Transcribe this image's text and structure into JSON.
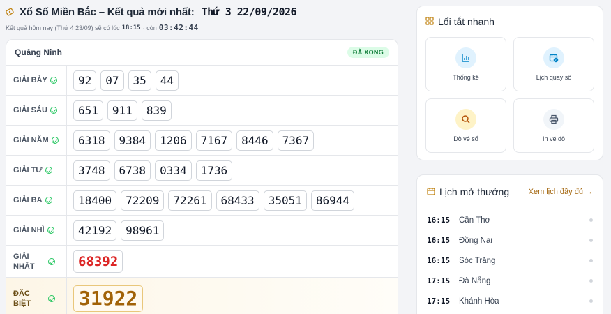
{
  "header": {
    "title": "Xổ Số Miền Bắc – Kết quả mới nhất:",
    "date": "Thứ 3  22/09/2026",
    "sub_prefix": "Kết quả hôm nay (Thứ 4 23/09) sẽ có lúc",
    "sub_time": "18:15",
    "sub_mid": "· còn",
    "countdown": "03:42:44"
  },
  "card": {
    "province": "Quảng Ninh",
    "status": "ĐÃ XONG"
  },
  "prizes": [
    {
      "label": "GIẢI BẢY",
      "numbers": [
        "92",
        "07",
        "35",
        "44"
      ]
    },
    {
      "label": "GIẢI SÁU",
      "numbers": [
        "651",
        "911",
        "839"
      ]
    },
    {
      "label": "GIẢI NĂM",
      "numbers": [
        "6318",
        "9384",
        "1206",
        "7167",
        "8446",
        "7367"
      ]
    },
    {
      "label": "GIẢI TƯ",
      "numbers": [
        "3748",
        "6738",
        "0334",
        "1736"
      ]
    },
    {
      "label": "GIẢI BA",
      "numbers": [
        "18400",
        "72209",
        "72261",
        "68433",
        "35051",
        "86944"
      ]
    },
    {
      "label": "GIẢI NHÌ",
      "numbers": [
        "42192",
        "98961"
      ]
    },
    {
      "label_lines": [
        "GIẢI",
        "NHẤT"
      ],
      "numbers": [
        "68392"
      ]
    },
    {
      "label_lines": [
        "ĐẶC",
        "BIỆT"
      ],
      "numbers": [
        "31922"
      ]
    }
  ],
  "quick": {
    "title": "Lối tắt nhanh",
    "tiles": [
      {
        "label": "Thống kê",
        "icon": "chart-icon"
      },
      {
        "label": "Lịch quay số",
        "icon": "calendar-clock-icon"
      },
      {
        "label": "Dò vé số",
        "icon": "search-icon"
      },
      {
        "label": "In vé dò",
        "icon": "printer-icon"
      }
    ]
  },
  "schedule": {
    "title": "Lịch mở thưởng",
    "link": "Xem lịch đầy đủ →",
    "items": [
      {
        "time": "16:15",
        "name": "Cần Thơ"
      },
      {
        "time": "16:15",
        "name": "Đồng Nai"
      },
      {
        "time": "16:15",
        "name": "Sóc Trăng"
      },
      {
        "time": "17:15",
        "name": "Đà Nẵng"
      },
      {
        "time": "17:15",
        "name": "Khánh Hòa"
      }
    ]
  },
  "colors": {
    "accent": "#a16207",
    "success": "#22c55e",
    "first_prize": "#dc2626"
  }
}
